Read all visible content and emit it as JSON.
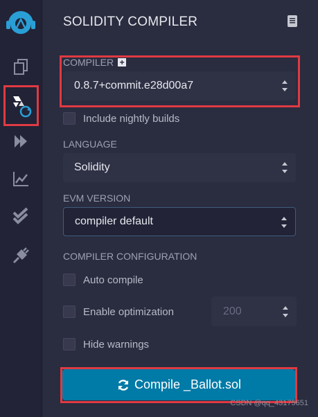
{
  "panel": {
    "title": "SOLIDITY COMPILER"
  },
  "compiler": {
    "label": "COMPILER",
    "version": "0.8.7+commit.e28d00a7",
    "nightly_label": "Include nightly builds"
  },
  "language": {
    "label": "LANGUAGE",
    "value": "Solidity"
  },
  "evm": {
    "label": "EVM VERSION",
    "value": "compiler default"
  },
  "config": {
    "label": "COMPILER CONFIGURATION",
    "auto_compile": "Auto compile",
    "optimization": "Enable optimization",
    "runs": "200",
    "hide_warnings": "Hide warnings"
  },
  "compile_button": "Compile _Ballot.sol",
  "watermark": "CSDN @qq_43175651",
  "colors": {
    "accent": "#007aa6",
    "highlight": "#e03a42",
    "logo": "#2a9fd6"
  }
}
